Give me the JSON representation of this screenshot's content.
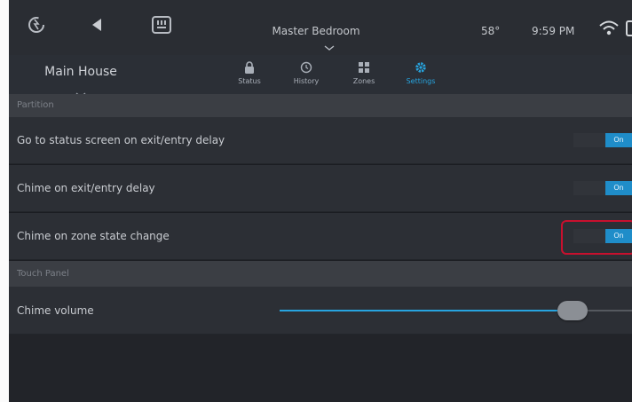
{
  "status_bar": {
    "room_title": "Master Bedroom",
    "temperature": "58°",
    "time": "9:59 PM",
    "icons": [
      "logo-icon",
      "back-arrow-icon",
      "keypad-icon",
      "chevron-down-icon",
      "wifi-icon"
    ]
  },
  "nav": {
    "location": "Main House",
    "tabs": [
      {
        "label": "Status",
        "icon": "lock-icon"
      },
      {
        "label": "History",
        "icon": "history-icon"
      },
      {
        "label": "Zones",
        "icon": "grid-icon"
      },
      {
        "label": "Settings",
        "icon": "gear-icon",
        "active": true
      }
    ]
  },
  "sections": {
    "partition": "Partition",
    "touch_panel": "Touch Panel"
  },
  "settings": [
    {
      "label": "Go to status screen on exit/entry delay",
      "state": "On"
    },
    {
      "label": "Chime on exit/entry delay",
      "state": "On"
    },
    {
      "label": "Chime on zone state change",
      "state": "On"
    }
  ],
  "chime_volume": {
    "label": "Chime volume",
    "level_fraction": 0.86
  },
  "colors": {
    "accent": "#27a4df",
    "highlight": "#c8102e"
  }
}
